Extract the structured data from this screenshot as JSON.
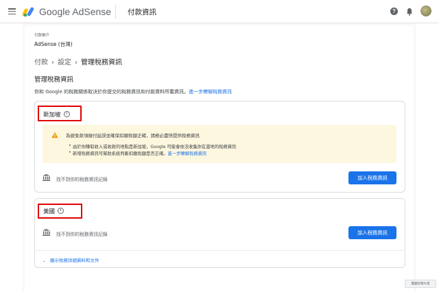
{
  "header": {
    "brand": "Google AdSense",
    "page_title": "付款資訊",
    "menu_icon": "menu-icon",
    "help_icon": "help-icon",
    "help_glyph": "?",
    "notification_icon": "bell-icon",
    "avatar_icon": "avatar"
  },
  "account": {
    "label": "付款帳戶",
    "value": "AdSense (台灣)"
  },
  "breadcrumb": {
    "items": [
      "付款",
      "設定",
      "管理稅務資訊"
    ],
    "separator": "›"
  },
  "section": {
    "title": "管理稅務資訊",
    "description": "你和 Google 的稅務關係取決於你提交的稅務資訊和付款資料所載資訊。",
    "learn_more": "進一步瞭解稅務資訊"
  },
  "singapore": {
    "country": "新加坡",
    "info_glyph": "i",
    "warning": {
      "title": "為避免款項撥付延誤並確保扣繳稅額正確，請務必盡快提供稅務資訊",
      "bullet1": "由於你賺取收入或收款的地點是新加坡，Google 可能會依法收集你在當地的稅務資訊",
      "bullet2_text": "新增稅務資訊可幫助系統判斷扣繳稅額是否正確。",
      "bullet2_link": "進一步瞭解稅務資訊"
    },
    "not_found": "找不到你的稅務資訊記錄",
    "button": "加入稅務資訊"
  },
  "usa": {
    "country": "美國",
    "info_glyph": "i",
    "not_found": "找不到你的稅務資訊記錄",
    "button": "加入稅務資訊"
  },
  "expand": {
    "label": "顯示稅務詳細資料和文件",
    "chevron": "⌄"
  },
  "watermark": "電腦玩物大叔",
  "colors": {
    "primary": "#1a73e8",
    "warning_bg": "#fef7e0",
    "warning_icon": "#f29900",
    "highlight": "#e00000"
  }
}
